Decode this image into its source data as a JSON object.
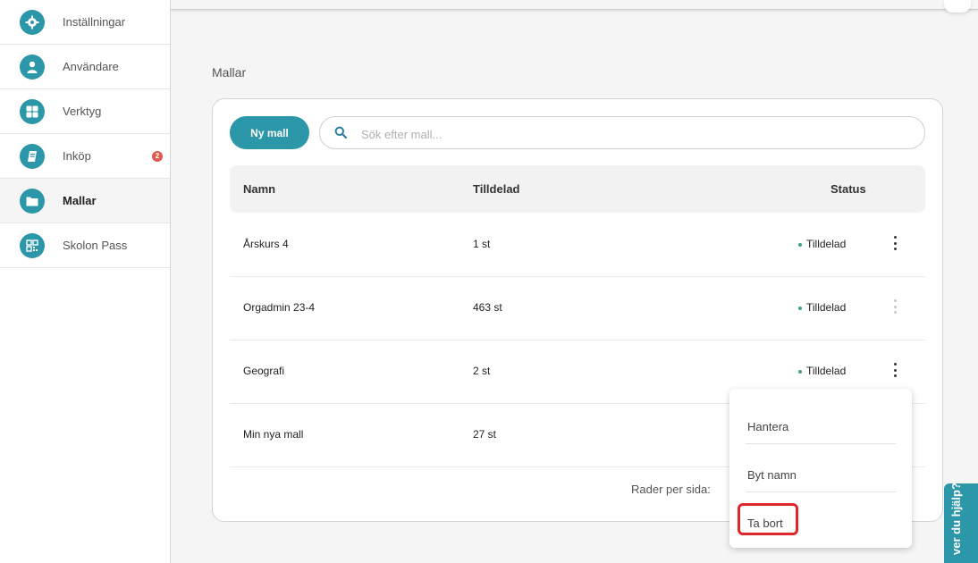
{
  "sidebar": {
    "items": [
      {
        "label": "Inställningar",
        "icon": "gear-icon"
      },
      {
        "label": "Användare",
        "icon": "user-icon"
      },
      {
        "label": "Verktyg",
        "icon": "grid-icon"
      },
      {
        "label": "Inköp",
        "icon": "book-icon",
        "badge": "2"
      },
      {
        "label": "Mallar",
        "icon": "folder-icon",
        "active": true
      },
      {
        "label": "Skolon Pass",
        "icon": "qr-code-icon"
      }
    ]
  },
  "main": {
    "title": "Mallar",
    "new_button": "Ny mall",
    "search_placeholder": "Sök efter mall...",
    "columns": [
      "Namn",
      "Tilldelad",
      "Status"
    ],
    "rows": [
      {
        "name": "Årskurs 4",
        "assigned": "1 st",
        "status": "Tilldelad"
      },
      {
        "name": "Orgadmin 23-4",
        "assigned": "463 st",
        "status": "Tilldelad"
      },
      {
        "name": "Geografi",
        "assigned": "2 st",
        "status": "Tilldelad"
      },
      {
        "name": "Min nya mall",
        "assigned": "27 st",
        "status": ""
      }
    ],
    "rows_per_page_label": "Rader per sida:"
  },
  "context_menu": {
    "items": [
      "Hantera",
      "Byt namn",
      "Ta bort"
    ]
  },
  "help_tab": {
    "label": "ver du hjälp?"
  },
  "colors": {
    "accent": "#2b97a8",
    "status_dot": "#3aa57a",
    "badge": "#e05a4f",
    "highlight": "#e0262a"
  }
}
